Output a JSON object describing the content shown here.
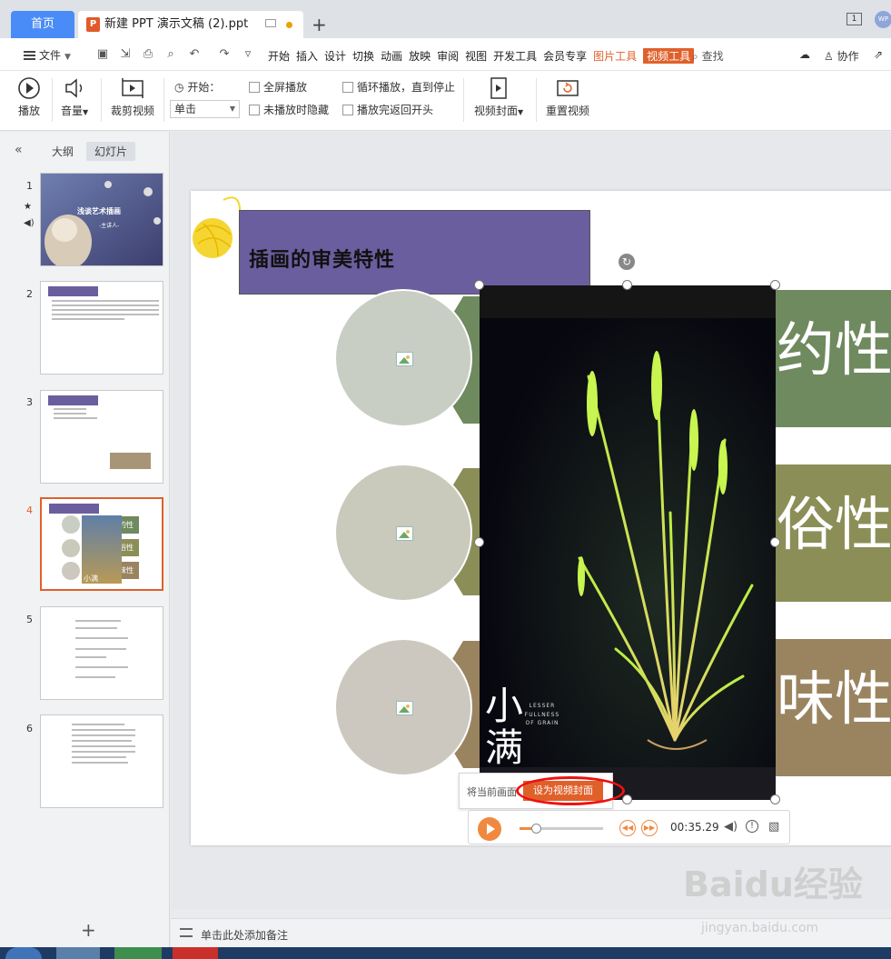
{
  "tabbar": {
    "home_label": "首页",
    "doc_title": "新建 PPT 演示文稿 (2).ppt",
    "doc_icon_letter": "P",
    "page_indicator": "1",
    "avatar_text": "WP"
  },
  "menubar": {
    "file_label": "文件",
    "items": [
      "开始",
      "插入",
      "设计",
      "切换",
      "动画",
      "放映",
      "审阅",
      "视图",
      "开发工具",
      "会员专享",
      "图片工具",
      "视频工具"
    ],
    "search_label": "查找",
    "collab_label": "协作"
  },
  "ribbon": {
    "play_label": "播放",
    "volume_label": "音量",
    "trim_label": "裁剪视频",
    "start_label": "开始：",
    "start_value": "单击",
    "fullscreen_label": "全屏播放",
    "hide_label": "未播放时隐藏",
    "loop_label": "循环播放，直到停止",
    "rewind_label": "播放完返回开头",
    "cover_label": "视频封面",
    "reset_label": "重置视频"
  },
  "leftpanel": {
    "tab_outline": "大纲",
    "tab_slides": "幻灯片",
    "slides": [
      "1",
      "2",
      "3",
      "4",
      "5",
      "6"
    ],
    "thumb1_title": "浅谈艺术插画",
    "thumb1_sub": "-主讲人-",
    "thumb4_labels": [
      "约性",
      "俗性",
      "味性"
    ],
    "thumb4_video_text": "小满"
  },
  "slide": {
    "title": "插画的审美特性",
    "bands": [
      "约性",
      "俗性",
      "味性"
    ],
    "video_text_big": "小满",
    "video_text_small": "LESSER FULLNESS OF GRAIN"
  },
  "player": {
    "cover_hint": "将当前画面",
    "cover_button": "设为视频封面",
    "time": "00:35.29",
    "progress": 0.2
  },
  "notes": {
    "placeholder": "单击此处添加备注"
  },
  "watermark": {
    "brand": "Baidu经验",
    "url": "jingyan.baidu.com"
  },
  "colors": {
    "accent": "#e0602a",
    "tab_active": "#4a8cf7",
    "title_box": "#6b5e9e",
    "band1": "#6e8a5e",
    "band2": "#8b8f57",
    "band3": "#9a8460",
    "player_orange": "#f0893f"
  }
}
